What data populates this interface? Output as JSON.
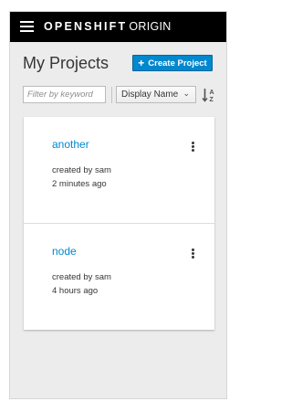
{
  "navbar": {
    "brand_bold": "OPENSHIFT",
    "brand_light": "ORIGIN",
    "menu_icon": "hamburger-menu-icon"
  },
  "header": {
    "title": "My Projects",
    "create_button_label": "Create Project",
    "create_icon": "plus-icon"
  },
  "toolbar": {
    "filter_placeholder": "Filter by keyword",
    "sort_selected": "Display Name",
    "sort_caret_icon": "chevron-down-icon",
    "sort_direction_icon": "sort-alpha-ascending-icon",
    "sort_icon_top": "A",
    "sort_icon_bottom": "Z"
  },
  "projects": [
    {
      "name": "another",
      "created_by": "created by sam",
      "created_ago": "2 minutes ago"
    },
    {
      "name": "node",
      "created_by": "created by sam",
      "created_ago": "4 hours ago"
    }
  ],
  "colors": {
    "navbar_bg": "#000000",
    "accent": "#0088ce",
    "page_bg": "#ececec"
  }
}
